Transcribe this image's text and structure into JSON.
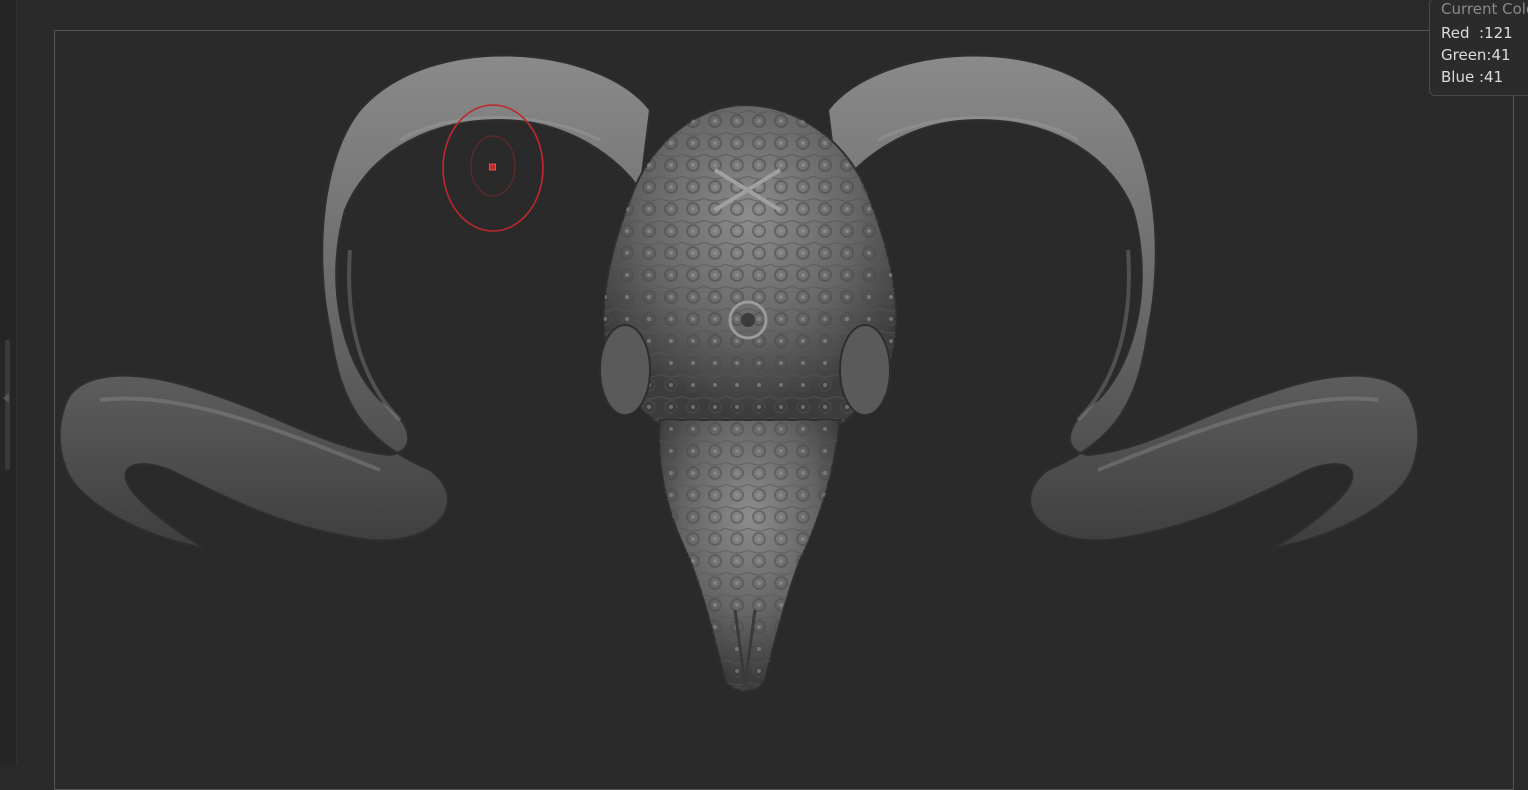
{
  "color_panel": {
    "title": "Current Colo",
    "red_label": "Red  :",
    "red_value": "121",
    "green_label": "Green:",
    "green_value": "41",
    "blue_label": "Blue :",
    "blue_value": "41"
  },
  "model": {
    "subject": "ram-skull-sculpt",
    "surface_color": "#7a7a7a"
  },
  "brush": {
    "cursor_color": "#c0282c"
  }
}
